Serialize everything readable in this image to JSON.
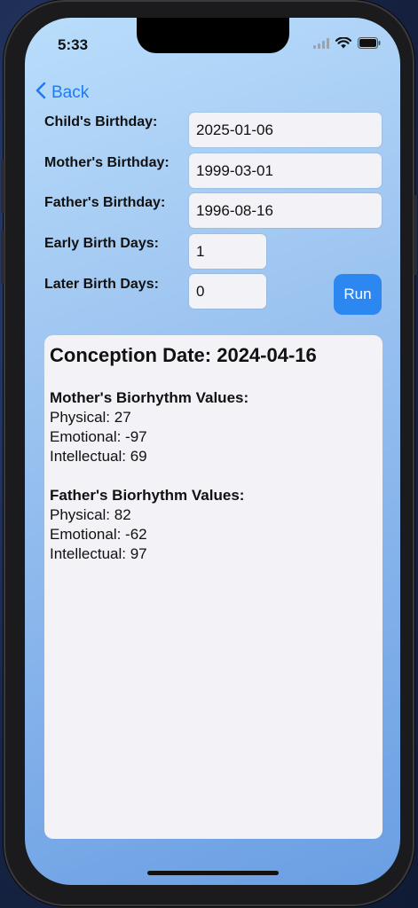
{
  "status_bar": {
    "time": "5:33",
    "icons": [
      "signal-icon",
      "wifi-icon",
      "battery-icon"
    ]
  },
  "nav": {
    "back_label": "Back",
    "back_icon": "chevron-left-icon"
  },
  "form": {
    "child_birthday": {
      "label": "Child's Birthday:",
      "value": "2025-01-06"
    },
    "mother_birthday": {
      "label": "Mother's Birthday:",
      "value": "1999-03-01"
    },
    "father_birthday": {
      "label": "Father's Birthday:",
      "value": "1996-08-16"
    },
    "early_birth_days": {
      "label": "Early Birth Days:",
      "value": "1"
    },
    "later_birth_days": {
      "label": "Later Birth Days:",
      "value": "0"
    },
    "run_label": "Run"
  },
  "result": {
    "title": "Conception Date: 2024-04-16",
    "mother": {
      "heading": "Mother's Biorhythm Values:",
      "physical": "Physical: 27",
      "emotional": "Emotional: -97",
      "intellectual": "Intellectual: 69"
    },
    "father": {
      "heading": "Father's Biorhythm Values:",
      "physical": "Physical: 82",
      "emotional": "Emotional: -62",
      "intellectual": "Intellectual: 97"
    }
  },
  "colors": {
    "accent": "#2d87f0",
    "back_link": "#1f7bf2",
    "field_bg": "#f2f2f7"
  }
}
